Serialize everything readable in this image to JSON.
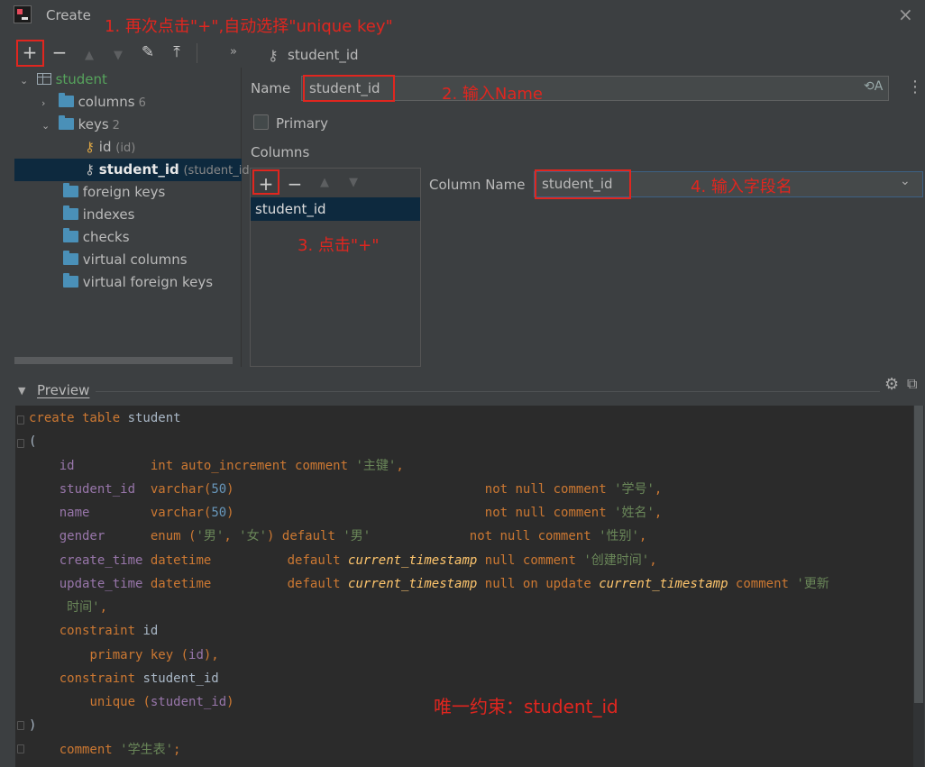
{
  "window": {
    "title": "Create"
  },
  "annotations": {
    "step1": "1. 再次点击\"+\",自动选择\"unique key\"",
    "step2": "2. 输入Name",
    "step3": "3. 点击\"+\"",
    "step4": "4. 输入字段名",
    "note": "唯一约束：student_id"
  },
  "tree": {
    "table": "student",
    "columns_label": "columns",
    "columns_count": "6",
    "keys_label": "keys",
    "keys_count": "2",
    "key1_label": "id",
    "key1_sub": "(id)",
    "key2_label": "student_id",
    "key2_sub": "(student_id",
    "foreign_keys": "foreign keys",
    "indexes": "indexes",
    "checks": "checks",
    "virtual_columns": "virtual columns",
    "virtual_foreign_keys": "virtual foreign keys"
  },
  "editor": {
    "breadcrumb": "student_id",
    "name_label": "Name",
    "name_value": "student_id",
    "primary_label": "Primary",
    "columns_label": "Columns",
    "column_item": "student_id",
    "column_name_label": "Column Name",
    "column_name_value": "student_id"
  },
  "preview": {
    "label": "Preview",
    "lines": {
      "l1a": "create table ",
      "l1b": "student",
      "l2": "(",
      "l3a": "id",
      "l3b": "int auto_increment comment ",
      "l3c": "'主键'",
      "l3d": ",",
      "l4a": "student_id",
      "l4b": "varchar(",
      "l4c": "50",
      "l4d": ")",
      "l4e": "not null comment ",
      "l4f": "'学号'",
      "l4g": ",",
      "l5a": "name",
      "l5b": "varchar(",
      "l5c": "50",
      "l5d": ")",
      "l5e": "not null comment ",
      "l5f": "'姓名'",
      "l5g": ",",
      "l6a": "gender",
      "l6b": "enum (",
      "l6c": "'男'",
      "l6d": ", ",
      "l6e": "'女'",
      "l6f": ") default ",
      "l6g": "'男'",
      "l6h": "not null comment ",
      "l6i": "'性别'",
      "l6j": ",",
      "l7a": "create_time",
      "l7b": "datetime",
      "l7c": "default ",
      "l7d": "current_timestamp",
      "l7e": " null comment ",
      "l7f": "'创建时间'",
      "l7g": ",",
      "l8a": "update_time",
      "l8b": "datetime",
      "l8c": "default ",
      "l8d": "current_timestamp",
      "l8e": " null on update ",
      "l8f": "current_timestamp",
      "l8g": " comment ",
      "l8h": "'更新",
      "l9a": "时间'",
      "l9b": ",",
      "l10a": "constraint ",
      "l10b": "id",
      "l11a": "primary key (",
      "l11b": "id",
      "l11c": "),",
      "l12a": "constraint ",
      "l12b": "student_id",
      "l13a": "unique (",
      "l13b": "student_id",
      "l13c": ")",
      "l14": ")",
      "l15a": "comment ",
      "l15b": "'学生表'",
      "l15c": ";"
    }
  },
  "colors": {
    "annotation": "#e0261f",
    "keyword": "#cc7832",
    "field": "#9876aa",
    "string": "#6a8759",
    "number": "#6897bb",
    "function": "#ffc66d",
    "selection": "#0d293e"
  }
}
